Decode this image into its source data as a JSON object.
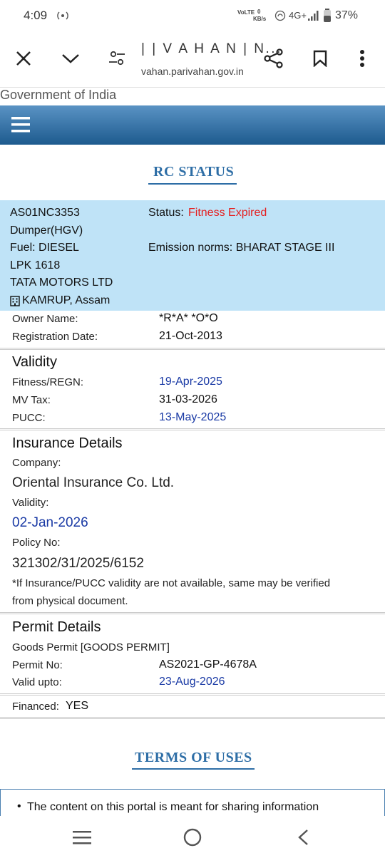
{
  "status_bar": {
    "time": "4:09",
    "volte": "VoLTE",
    "kbs_value": "0",
    "kbs_unit": "KB/s",
    "network": "4G+",
    "battery": "37%"
  },
  "browser": {
    "page_title": "| | V A H A N | N...",
    "url": "vahan.parivahan.gov.in"
  },
  "page": {
    "gov_label": "Government of India",
    "rc_heading": "RC STATUS",
    "vehicle": {
      "reg_no": "AS01NC3353",
      "class": "Dumper(HGV)",
      "fuel": "Fuel: DIESEL",
      "model": "LPK 1618",
      "maker": "TATA MOTORS LTD",
      "rto": "KAMRUP, Assam",
      "status_label": "Status:",
      "status_value": "Fitness Expired",
      "emission": "Emission norms: BHARAT STAGE III"
    },
    "owner": {
      "owner_label": "Owner Name:",
      "owner_value": "*R*A* *O*O",
      "reg_date_label": "Registration Date:",
      "reg_date_value": "21-Oct-2013"
    },
    "validity": {
      "title": "Validity",
      "fitness_label": "Fitness/REGN:",
      "fitness_value": "19-Apr-2025",
      "tax_label": "MV Tax:",
      "tax_value": "31-03-2026",
      "pucc_label": "PUCC:",
      "pucc_value": "13-May-2025"
    },
    "insurance": {
      "title": "Insurance Details",
      "company_label": "Company:",
      "company_value": "Oriental Insurance Co. Ltd.",
      "validity_label": "Validity:",
      "validity_value": "02-Jan-2026",
      "policy_label": "Policy No:",
      "policy_value": "321302/31/2025/6152",
      "note_line1": "*If Insurance/PUCC validity are not available, same may be verified",
      "note_line2": "from physical document."
    },
    "permit": {
      "title": "Permit Details",
      "type": "Goods Permit [GOODS PERMIT]",
      "no_label": "Permit No:",
      "no_value": "AS2021-GP-4678A",
      "valid_label": "Valid upto:",
      "valid_value": "23-Aug-2026"
    },
    "financed_label": "Financed:",
    "financed_value": "YES",
    "terms_heading": "TERMS OF USES",
    "terms_item": "The content on this portal is meant for sharing information"
  },
  "colors": {
    "accent_blue": "#2e6ea6",
    "info_bg": "#bfe3f7",
    "status_red": "#e51e1e",
    "date_blue": "#1a3aa5"
  },
  "icons": [
    "close-icon",
    "chevron-down-icon",
    "tune-icon",
    "share-icon",
    "bookmark-icon",
    "more-vert-icon",
    "hamburger-menu-icon",
    "building-icon",
    "recent-apps-icon",
    "home-icon",
    "back-icon"
  ]
}
